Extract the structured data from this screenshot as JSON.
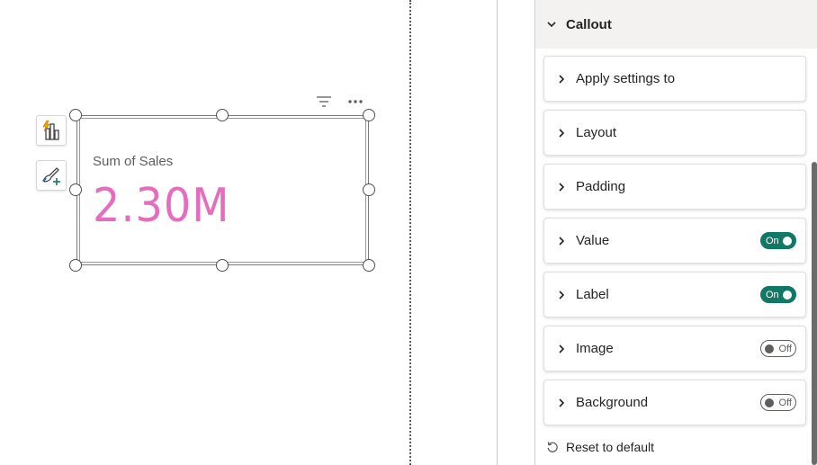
{
  "visual": {
    "label": "Sum of Sales",
    "value": "2.30M",
    "value_color": "#e66cbd"
  },
  "toolbar_icons": [
    "quick-insights-icon",
    "format-brush-add-icon"
  ],
  "visual_header_icons": [
    "filter-icon",
    "more-options-icon"
  ],
  "format_pane": {
    "section_title": "Callout",
    "cards": [
      {
        "title": "Apply settings to",
        "toggle": null
      },
      {
        "title": "Layout",
        "toggle": null
      },
      {
        "title": "Padding",
        "toggle": null
      },
      {
        "title": "Value",
        "toggle": "On"
      },
      {
        "title": "Label",
        "toggle": "On"
      },
      {
        "title": "Image",
        "toggle": "Off"
      },
      {
        "title": "Background",
        "toggle": "Off"
      }
    ],
    "reset_label": "Reset to default",
    "accent_color": "#117865"
  }
}
